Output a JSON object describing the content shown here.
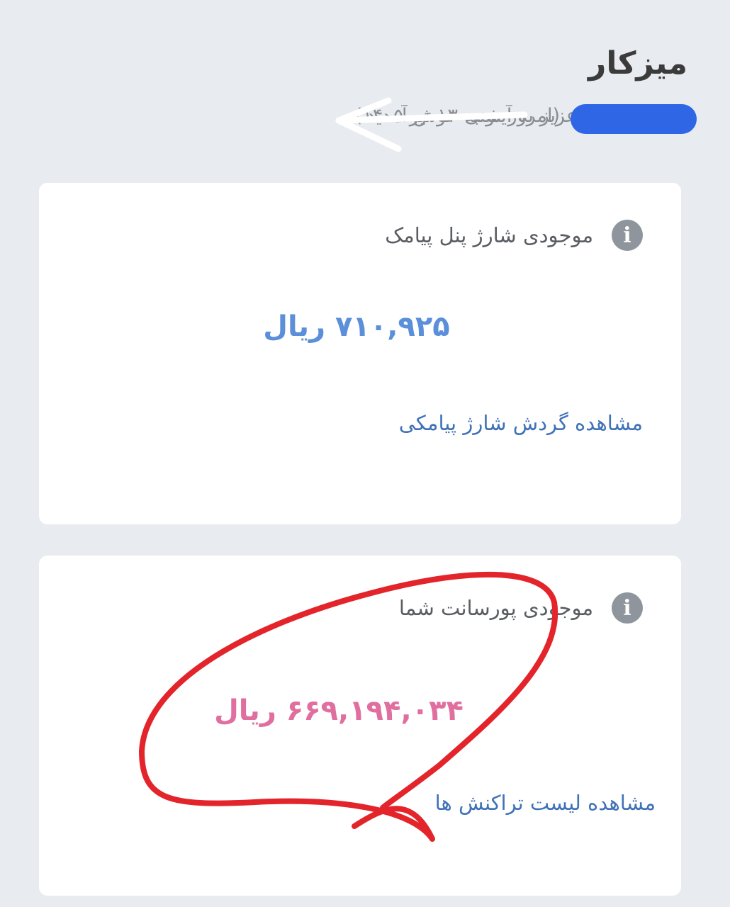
{
  "header": {
    "title": "میزکار",
    "welcome_text": "عزیز به آیتونی خوش آمدید",
    "date_text": "(امروز شنبه ۱۳ تیر ۱۴۰۵)"
  },
  "cards": [
    {
      "title": "موجودی شارژ پنل پیامک",
      "amount": "۷۱۰,۹۲۵ ریال",
      "link": "مشاهده گردش شارژ پیامکی",
      "amount_color": "#5b8fd9"
    },
    {
      "title": "موجودی پورسانت شما",
      "amount": "۶۶۹,۱۹۴,۰۳۴ ریال",
      "link": "مشاهده لیست تراکنش ها",
      "amount_color": "#e06fa0"
    }
  ],
  "icons": {
    "info": "info-circle-icon"
  },
  "colors": {
    "background": "#e8ebef",
    "redaction": "#2e66e6",
    "annotation_red": "#e3242b",
    "annotation_arrow": "#ffffff",
    "link": "#3f72b8"
  }
}
